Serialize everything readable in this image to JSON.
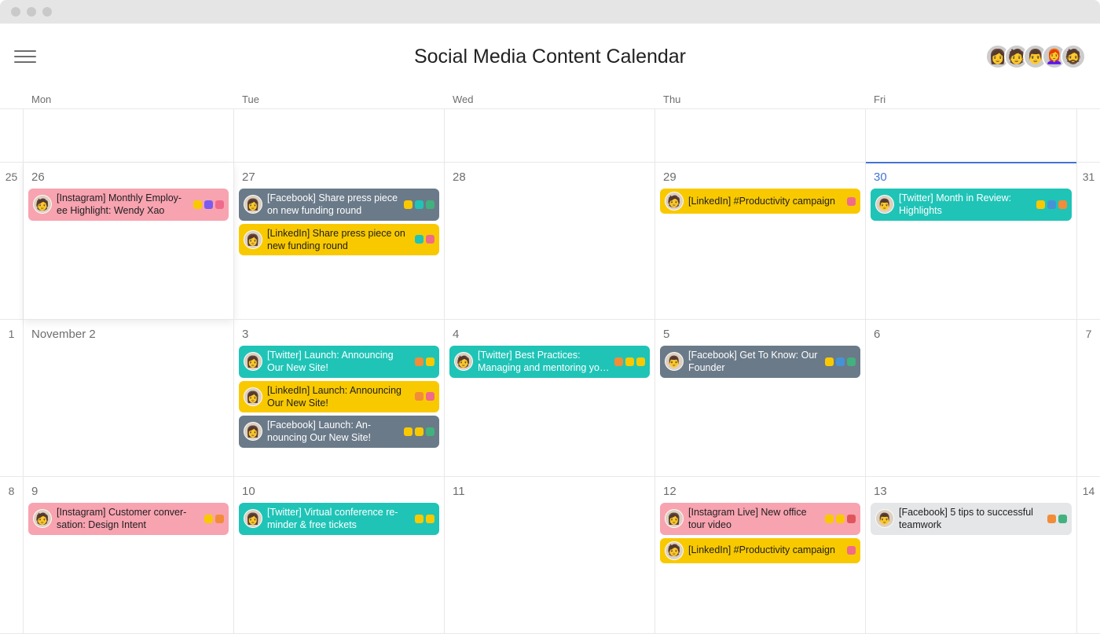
{
  "header": {
    "title": "Social Media Content Calendar"
  },
  "weekdays": [
    "Mon",
    "Tue",
    "Wed",
    "Thu",
    "Fri"
  ],
  "avatar_faces": [
    "👩",
    "🧑",
    "👨",
    "👩‍🦰",
    "🧔"
  ],
  "rows": [
    {
      "left": "",
      "right": "",
      "short": true,
      "cells": [
        {
          "label": "",
          "tasks": []
        },
        {
          "label": "",
          "tasks": []
        },
        {
          "label": "",
          "tasks": []
        },
        {
          "label": "",
          "tasks": []
        },
        {
          "label": "",
          "tasks": []
        }
      ]
    },
    {
      "left": "25",
      "right": "31",
      "cells": [
        {
          "label": "26",
          "shadow": true,
          "tasks": [
            {
              "color": "pink",
              "avatar": "🧑",
              "text": "[Instagram] Monthly Employ-ee Highlight: Wendy Xao",
              "tags": [
                "yellow",
                "purple",
                "pink"
              ]
            }
          ]
        },
        {
          "label": "27",
          "tasks": [
            {
              "color": "slate",
              "avatar": "👩",
              "text": "[Facebook] Share press piece on new funding round",
              "tags": [
                "yellow",
                "teal",
                "green"
              ]
            },
            {
              "color": "yellow",
              "avatar": "👩",
              "text": "[LinkedIn] Share press piece on new funding round",
              "tags": [
                "teal",
                "pink"
              ]
            }
          ]
        },
        {
          "label": "28",
          "tasks": []
        },
        {
          "label": "29",
          "tasks": [
            {
              "color": "yellow",
              "avatar": "🧑",
              "text": "[LinkedIn] #Productivity campaign",
              "tags": [
                "pink"
              ]
            }
          ]
        },
        {
          "label": "30",
          "today": true,
          "tasks": [
            {
              "color": "teal",
              "avatar": "👨",
              "text": "[Twitter] Month in Review: Highlights",
              "tags": [
                "yellow",
                "blue",
                "orange"
              ]
            }
          ]
        }
      ]
    },
    {
      "left": "1",
      "right": "7",
      "cells": [
        {
          "label": "November 2",
          "tasks": []
        },
        {
          "label": "3",
          "tasks": [
            {
              "color": "teal",
              "avatar": "👩",
              "text": "[Twitter] Launch: Announcing Our New Site!",
              "tags": [
                "orange",
                "yellow"
              ]
            },
            {
              "color": "yellow",
              "avatar": "👩",
              "text": "[LinkedIn] Launch: Announcing Our New Site!",
              "tags": [
                "orange",
                "pink"
              ]
            },
            {
              "color": "slate",
              "avatar": "👩",
              "text": "[Facebook] Launch: An-nouncing Our New Site!",
              "tags": [
                "yellow",
                "yellow",
                "green"
              ]
            }
          ]
        },
        {
          "label": "4",
          "tasks": [
            {
              "color": "teal",
              "avatar": "🧑",
              "text": "[Twitter] Best Practices: Managing and mentoring yo…",
              "tags": [
                "orange",
                "yellow",
                "yellow"
              ]
            }
          ]
        },
        {
          "label": "5",
          "tasks": [
            {
              "color": "slate",
              "avatar": "👨",
              "text": "[Facebook] Get To Know: Our Founder",
              "tags": [
                "yellow",
                "blue",
                "green"
              ]
            }
          ]
        },
        {
          "label": "6",
          "tasks": []
        }
      ]
    },
    {
      "left": "8",
      "right": "14",
      "cells": [
        {
          "label": "9",
          "tasks": [
            {
              "color": "pink",
              "avatar": "🧑",
              "text": "[Instagram] Customer conver-sation: Design Intent",
              "tags": [
                "yellow",
                "orange"
              ]
            }
          ]
        },
        {
          "label": "10",
          "tasks": [
            {
              "color": "teal",
              "avatar": "👩",
              "text": "[Twitter] Virtual conference re-minder & free tickets",
              "tags": [
                "yellow",
                "yellow"
              ]
            }
          ]
        },
        {
          "label": "11",
          "tasks": []
        },
        {
          "label": "12",
          "tasks": [
            {
              "color": "pink",
              "avatar": "👩",
              "text": "[Instagram Live] New office tour video",
              "tags": [
                "yellow",
                "yellow",
                "red"
              ]
            },
            {
              "color": "yellow",
              "avatar": "🧑",
              "text": "[LinkedIn] #Productivity campaign",
              "tags": [
                "pink"
              ]
            }
          ]
        },
        {
          "label": "13",
          "tasks": [
            {
              "color": "gray",
              "avatar": "👨",
              "text": "[Facebook] 5 tips to successful teamwork",
              "tags": [
                "orange",
                "green"
              ]
            }
          ]
        }
      ]
    }
  ]
}
